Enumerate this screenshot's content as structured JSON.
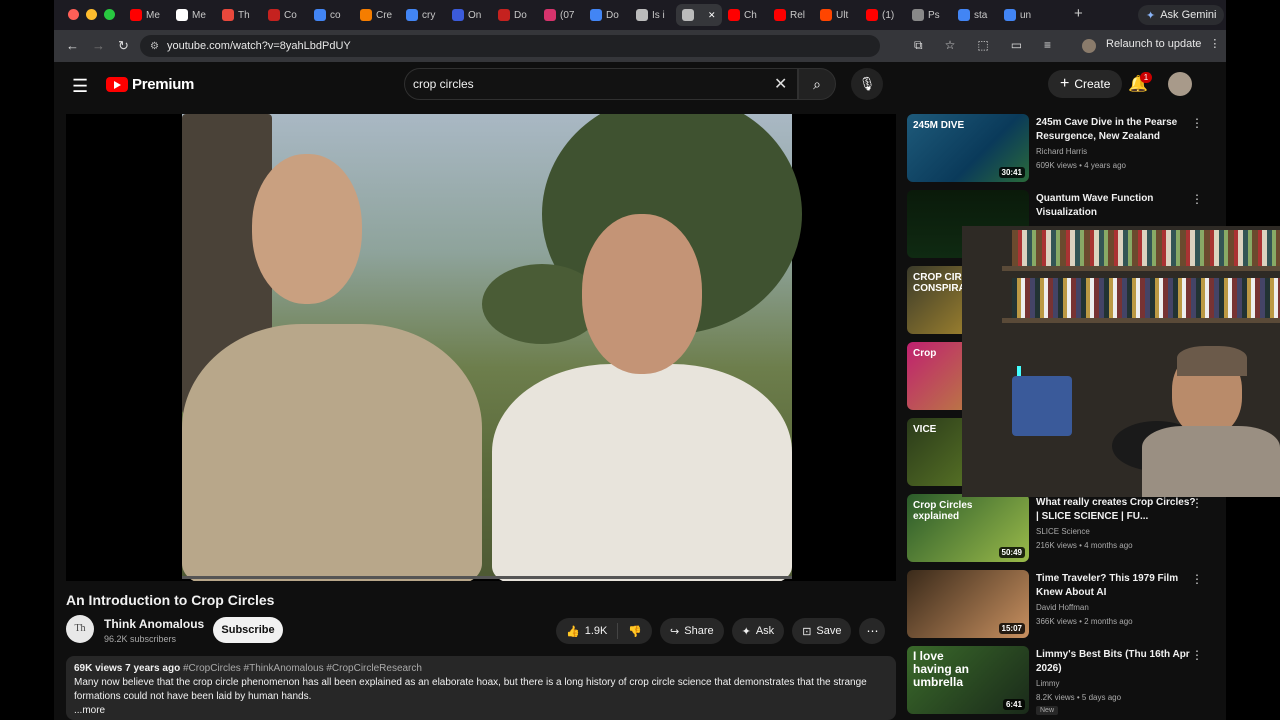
{
  "browser": {
    "tabs": [
      {
        "label": "Me",
        "favicon": "youtube-favicon",
        "color": "#ff0000"
      },
      {
        "label": "Me",
        "favicon": "wikipedia-favicon",
        "color": "#ffffff"
      },
      {
        "label": "Th",
        "favicon": "bookmark-favicon",
        "color": "#e8483c"
      },
      {
        "label": "Co",
        "favicon": "mail-favicon",
        "color": "#c5221f"
      },
      {
        "label": "co",
        "favicon": "google-favicon",
        "color": "#4285f4"
      },
      {
        "label": "Cre",
        "favicon": "blogger-favicon",
        "color": "#f57d00"
      },
      {
        "label": "cry",
        "favicon": "google-favicon",
        "color": "#4285f4"
      },
      {
        "label": "On",
        "favicon": "doc-favicon",
        "color": "#3b5bdb"
      },
      {
        "label": "Do",
        "favicon": "gmail-favicon",
        "color": "#c5221f"
      },
      {
        "label": "(07",
        "favicon": "k-favicon",
        "color": "#d6336c"
      },
      {
        "label": "Do",
        "favicon": "docs-favicon",
        "color": "#4285f4"
      },
      {
        "label": "Is i",
        "favicon": "generic-favicon",
        "color": "#bbbbbb"
      },
      {
        "label": "",
        "favicon": "audio-icon",
        "color": "#bbbbbb",
        "active": true
      },
      {
        "label": "Ch",
        "favicon": "youtube-favicon",
        "color": "#ff0000"
      },
      {
        "label": "Rel",
        "favicon": "youtube-favicon",
        "color": "#ff0000"
      },
      {
        "label": "Ult",
        "favicon": "reddit-favicon",
        "color": "#ff4500"
      },
      {
        "label": "(1)",
        "favicon": "youtube-favicon",
        "color": "#ff0000"
      },
      {
        "label": "Ps",
        "favicon": "generic-favicon",
        "color": "#888888"
      },
      {
        "label": "sta",
        "favicon": "google-favicon",
        "color": "#4285f4"
      },
      {
        "label": "un",
        "favicon": "google-favicon",
        "color": "#4285f4"
      }
    ],
    "ask_gemini": "Ask Gemini",
    "url": "youtube.com/watch?v=8yahLbdPdUY",
    "relaunch": "Relaunch to update"
  },
  "youtube": {
    "logo_text": "Premium",
    "search_value": "crop circles",
    "create_label": "Create",
    "notification_count": "1",
    "video": {
      "title": "An Introduction to Crop Circles",
      "channel": "Think Anomalous",
      "channel_initials": "Th",
      "subscribers": "96.2K subscribers",
      "subscribe_label": "Subscribe",
      "likes": "1.9K",
      "share_label": "Share",
      "ask_label": "Ask",
      "save_label": "Save",
      "views_date": "69K views  7 years ago",
      "hashtags": "#CropCircles #ThinkAnomalous #CropCircleResearch",
      "description": "Many now believe that the crop circle phenomenon has all been explained as an elaborate hoax, but there is a long history of crop circle science that demonstrates that the strange formations could not have been laid by human hands.",
      "more_label": "...more"
    },
    "recommendations": [
      {
        "title": "245m Cave Dive in the Pearse Resurgence, New Zealand",
        "channel": "Richard Harris",
        "meta": "609K views • 4 years ago",
        "duration": "30:41",
        "thumb_text": "245M DIVE"
      },
      {
        "title": "Quantum Wave Function Visualization",
        "channel": "",
        "meta": "",
        "duration": "",
        "thumb_text": ""
      },
      {
        "title": "",
        "channel": "",
        "meta": "",
        "duration": "",
        "thumb_text": "CROP CIR CONSPIRA"
      },
      {
        "title": "",
        "channel": "",
        "meta": "",
        "duration": "",
        "thumb_text": "Crop"
      },
      {
        "title": "",
        "channel": "",
        "meta": "",
        "duration": "",
        "thumb_text": "VICE"
      },
      {
        "title": "What really creates Crop Circles? | SLICE SCIENCE | FU...",
        "channel": "SLICE Science",
        "meta": "216K views • 4 months ago",
        "duration": "50:49",
        "thumb_text": "Crop Circles explained"
      },
      {
        "title": "Time Traveler? This 1979 Film Knew About AI",
        "channel": "David Hoffman",
        "meta": "366K views • 2 months ago",
        "duration": "15:07",
        "thumb_text": ""
      },
      {
        "title": "Limmy's Best Bits (Thu 16th Apr 2026)",
        "channel": "Limmy",
        "meta": "8.2K views • 5 days ago",
        "duration": "6:41",
        "thumb_text": "I love having an umbrella",
        "badge": "New"
      }
    ]
  }
}
